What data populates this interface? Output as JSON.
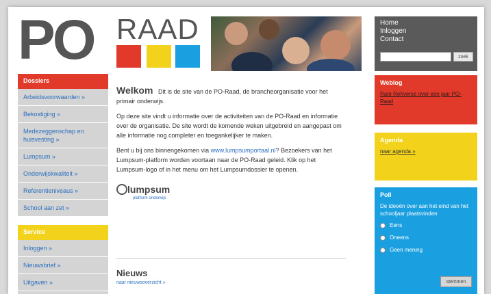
{
  "header": {
    "logo_po": "PO",
    "logo_raad": "RAAD"
  },
  "topnav": {
    "items": [
      "Home",
      "Inloggen",
      "Contact"
    ],
    "search_button": "zoek"
  },
  "sidebar": {
    "dossiers_title": "Dossiers",
    "dossiers": [
      "Arbeidsvoorwaarden »",
      "Bekostiging »",
      "Medezeggenschap en huisvesting »",
      "Lumpsum »",
      "Onderwijskwaliteit »",
      "Referentieniveaus »",
      "School aan zet »"
    ],
    "service_title": "Service",
    "service": [
      "Inloggen »",
      "Nieuwsbrief »",
      "Uitgaven »"
    ]
  },
  "content": {
    "welcome_title": "Welkom",
    "welcome_intro": "Dit is de site van de PO-Raad, de brancheorganisatie voor het primair onderwijs.",
    "para2": "Op deze site vindt u informatie over de activiteiten van de PO-Raad en informatie over de organisatie. De site wordt de komende weken uitgebreid en aangepast om alle informatie nog completer en toegankelijker te maken.",
    "para3_pre": "Bent u bij ons binnengekomen via ",
    "para3_link": "www.lumpsumportaal.nl",
    "para3_post": "? Bezoekers van het Lumpsum-platform worden voortaan naar de PO-Raad geleid. Klik op het Lumpsum-logo of in het menu om het Lumpsumdossier te openen.",
    "lumpsum_logo": "lumpsum",
    "lumpsum_sub": "platform onderwijs",
    "news_title": "Nieuws",
    "news_link": "naar nieuwsoverzicht »"
  },
  "weblog": {
    "title": "Weblog",
    "link": "Rate Rehverse over een jaar PO-Raad"
  },
  "agenda": {
    "title": "Agenda",
    "link": "naar agenda »"
  },
  "poll": {
    "title": "Poll",
    "question": "De ideeën over aan het eind van het schooljaar plaatsvinden",
    "options": [
      "Eens",
      "Oneens",
      "Geen mening"
    ],
    "vote_button": "stemmen"
  }
}
